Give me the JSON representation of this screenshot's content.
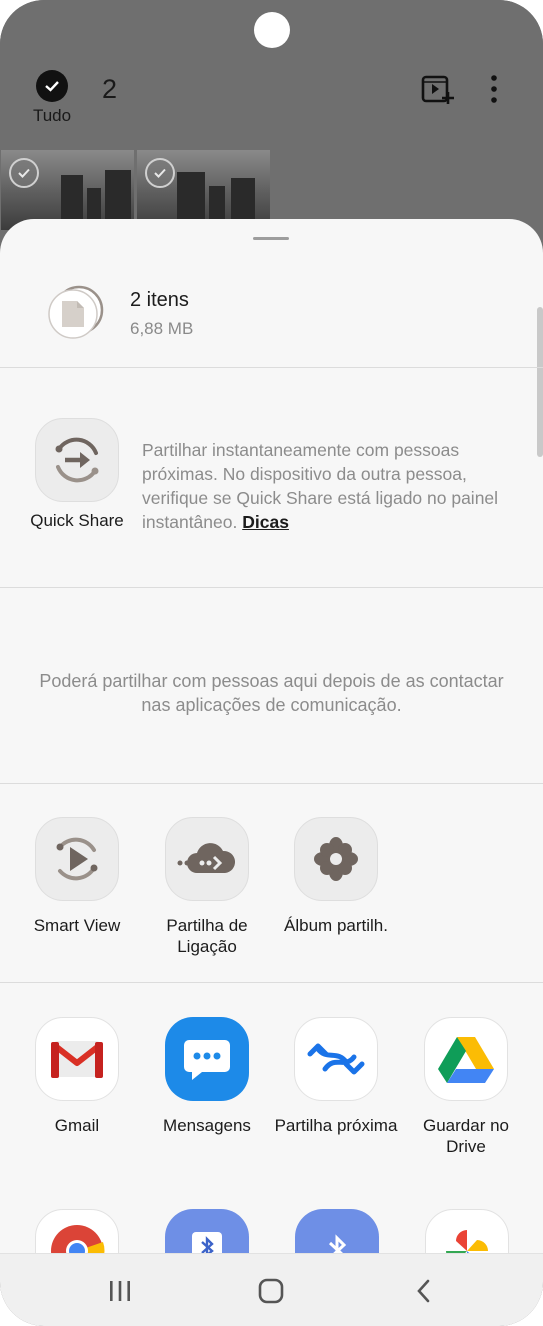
{
  "gallery": {
    "select_all_label": "Tudo",
    "selected_count": "2"
  },
  "share_sheet": {
    "file_title": "2 itens",
    "file_size": "6,88 MB",
    "quick_share": {
      "label": "Quick Share",
      "description": "Partilhar instantaneamente com pessoas próximas. No dispositivo da outra pessoa, verifique se Quick Share está ligado no painel instantâneo.",
      "tips_link": "Dicas"
    },
    "people_info": "Poderá partilhar com pessoas aqui depois de as contactar nas aplicações de comunicação.",
    "actions": [
      {
        "label": "Smart View",
        "icon": "smart-view-icon"
      },
      {
        "label": "Partilha de Ligação",
        "icon": "link-share-cloud-icon"
      },
      {
        "label": "Álbum partilh.",
        "icon": "shared-album-flower-icon"
      }
    ],
    "apps": [
      {
        "label": "Gmail",
        "icon": "gmail-icon"
      },
      {
        "label": "Mensagens",
        "icon": "messages-icon"
      },
      {
        "label": "Partilha próxima",
        "icon": "nearby-share-icon"
      },
      {
        "label": "Guardar no Drive",
        "icon": "google-drive-icon"
      }
    ]
  },
  "navbar": {
    "recents_icon": "recents-icon",
    "home_icon": "home-icon",
    "back_icon": "back-icon"
  },
  "colors": {
    "sheet_bg": "#f7f7f7",
    "dim_overlay": "#6f6f6f",
    "text_primary": "#1c1c1c",
    "text_secondary": "#8c8c8c",
    "messages_blue": "#1d8ae8",
    "icon_brown": "#6f655f"
  }
}
